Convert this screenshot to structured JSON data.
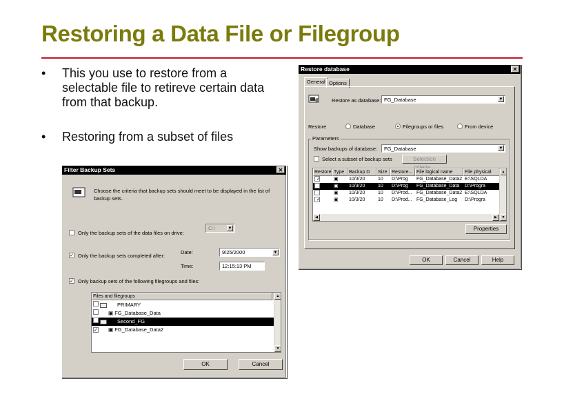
{
  "slide": {
    "title": "Restoring a Data File or Filegroup",
    "bullets": [
      "This you use to restore from a selectable file to retireve certain data from that backup.",
      "Restoring from a subset of files"
    ],
    "bullet_glyph": "•"
  },
  "restore_dialog": {
    "title": "Restore database",
    "close": "✕",
    "tabs": [
      "General",
      "Options"
    ],
    "restore_as_label": "Restore as database:",
    "restore_as_value": "FG_Database",
    "restore_label": "Restore",
    "radio_options": [
      "Database",
      "Filegroups or files",
      "From device"
    ],
    "selected_radio": "Filegroups or files",
    "parameters_label": "Parameters",
    "show_backups_label": "Show backups of database:",
    "show_backups_value": "FG_Database",
    "subset_label": "Select a subset of backup sets",
    "selection_criteria": "Selection criteria...",
    "columns": [
      "Restore",
      "Type",
      "Backup D",
      "Size",
      "Restore...",
      "File logical name",
      "File physical"
    ],
    "rows": [
      {
        "date": "10/3/20",
        "size": "10",
        "restore_from": "D:\\Prog",
        "logical": "FG_Database_Data2",
        "physical": "E:\\SQLDA"
      },
      {
        "date": "10/3/20",
        "size": "10",
        "restore_from": "D:\\Prog",
        "logical": "FG_Database_Data",
        "physical": "D:\\Progra"
      },
      {
        "date": "10/3/20",
        "size": "10",
        "restore_from": "D:\\Prod...",
        "logical": "FG_Database_Data2",
        "physical": "E:\\SQLDA"
      },
      {
        "date": "10/3/20",
        "size": "10",
        "restore_from": "D:\\Prod...",
        "logical": "FG_Database_Log",
        "physical": "D:\\Progra"
      }
    ],
    "properties": "Properties",
    "buttons": [
      "OK",
      "Cancel",
      "Help"
    ]
  },
  "filter_dialog": {
    "title": "Filter Backup Sets",
    "close": "✕",
    "intro": "Choose the criteria that backup sets should meet to be displayed in the list of backup sets.",
    "drive_label": "Only the backup sets of the data files on drive:",
    "drive_value": "C:\\",
    "completed_label": "Only the backup sets completed after:",
    "date_label": "Date:",
    "date_value": "9/25/2000",
    "time_label": "Time:",
    "time_value": "12:15:13 PM",
    "filegroups_label": "Only backup sets of the following filegroups and files:",
    "tree_header": "Files and filegroups",
    "tree_items": [
      "PRIMARY",
      "FG_Database_Data",
      "Second_FG",
      "FG_Database_Data2"
    ],
    "buttons": [
      "OK",
      "Cancel"
    ]
  }
}
